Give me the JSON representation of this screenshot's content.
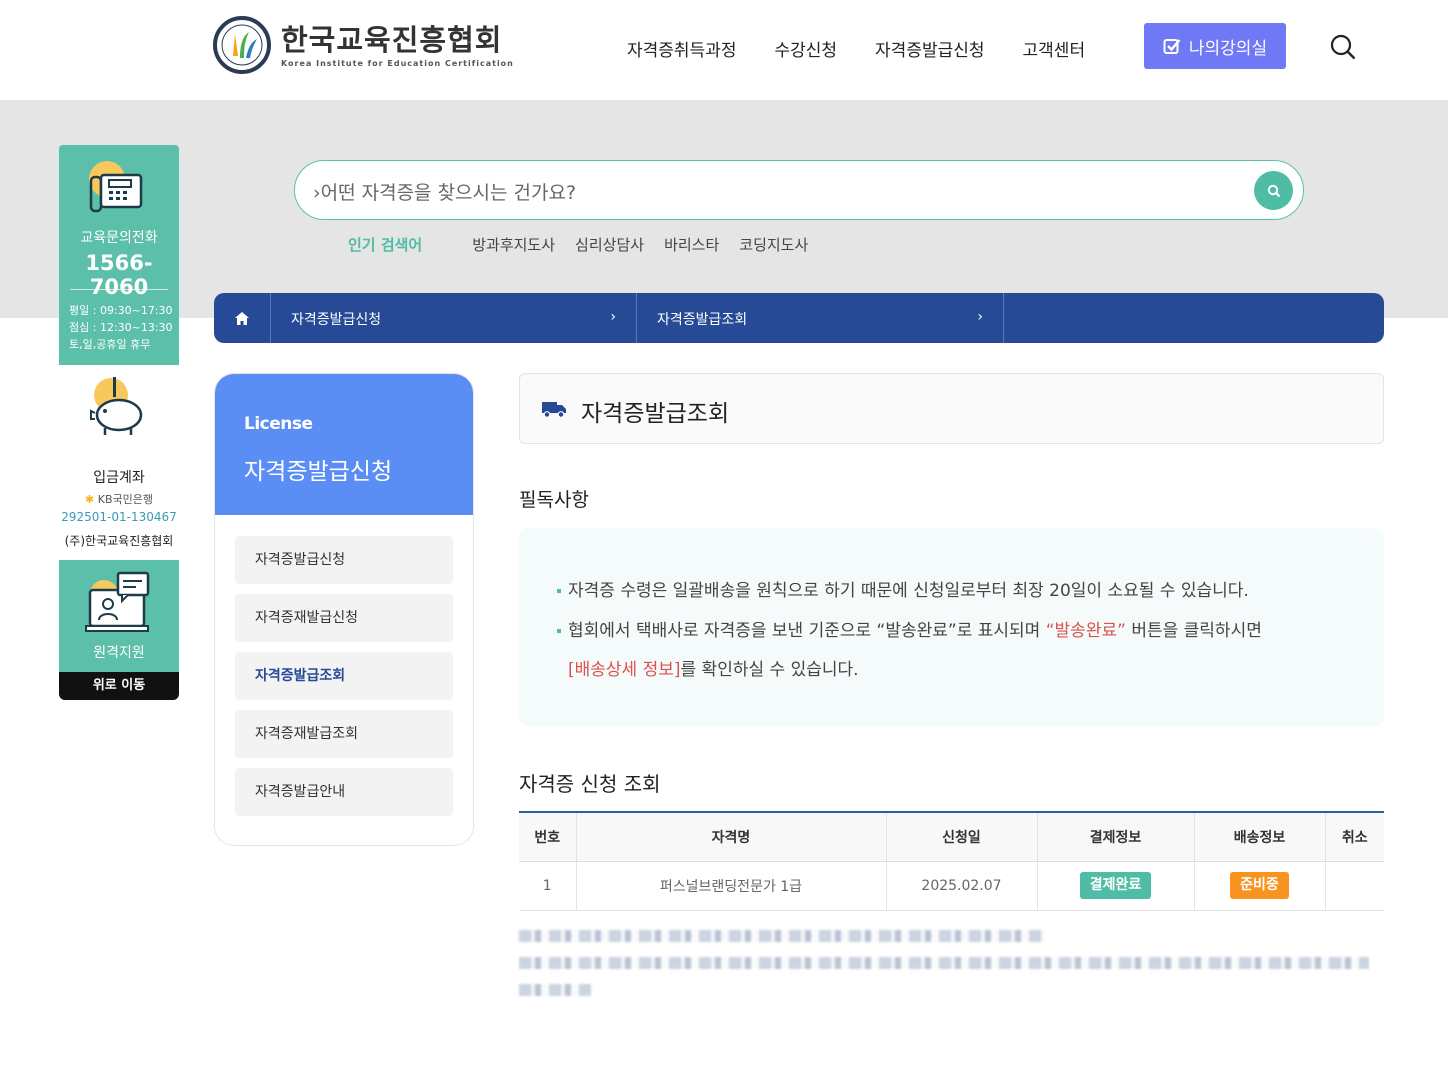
{
  "header": {
    "logo_title": "한국교육진흥협회",
    "logo_sub": "Korea Institute for Education Certification",
    "nav": [
      "자격증취득과정",
      "수강신청",
      "자격증발급신청",
      "고객센터"
    ],
    "mylecture_label": "나의강의실"
  },
  "search": {
    "placeholder": "어떤 자격증을 찾으시는 건가요?",
    "popular_label": "인기 검색어",
    "popular": [
      "방과후지도사",
      "심리상담사",
      "바리스타",
      "코딩지도사"
    ]
  },
  "quick": {
    "phone_label": "교육문의전화",
    "phone": "1566-7060",
    "hours": [
      "평일 : 09:30~17:30",
      "점심 : 12:30~13:30",
      "토,일,공휴일 휴무"
    ],
    "account_label": "입금계좌",
    "bank": "KB국민은행",
    "account": "292501-01-130467",
    "owner": "(주)한국교육진흥협회",
    "remote_label": "원격지원",
    "top_label": "위로 이동"
  },
  "breadcrumb": {
    "level1": "자격증발급신청",
    "level2": "자격증발급조회"
  },
  "side": {
    "en": "License",
    "ko": "자격증발급신청",
    "items": [
      "자격증발급신청",
      "자격증재발급신청",
      "자격증발급조회",
      "자격증재발급조회",
      "자격증발급안내"
    ],
    "active_index": 2
  },
  "content": {
    "title": "자격증발급조회",
    "notice_heading": "필독사항",
    "notice_1": "자격증 수령은 일괄배송을 원칙으로 하기 때문에 신청일로부터 최장 20일이 소요될 수 있습니다.",
    "notice_2a": "협회에서 택배사로 자격증을 보낸 기준으로 “발송완료”로 표시되며 ",
    "notice_2b": "“발송완료”",
    "notice_2c": " 버튼을 클릭하시면",
    "notice_3a": "[배송상세 정보]",
    "notice_3b": "를 확인하실 수 있습니다.",
    "table_heading": "자격증 신청 조회",
    "columns": [
      "번호",
      "자격명",
      "신청일",
      "결제정보",
      "배송정보",
      "취소"
    ],
    "rows": [
      {
        "no": "1",
        "name": "퍼스널브랜딩전문가 1급",
        "date": "2025.02.07",
        "payment": "결제완료",
        "delivery": "준비중",
        "cancel": ""
      }
    ]
  },
  "colors": {
    "teal": "#4fbca5",
    "navy": "#274a96",
    "side_head": "#5b8ef5",
    "mylecture": "#6f79f5",
    "badge_paid": "#4fbca5",
    "badge_ready": "#f7931e"
  }
}
